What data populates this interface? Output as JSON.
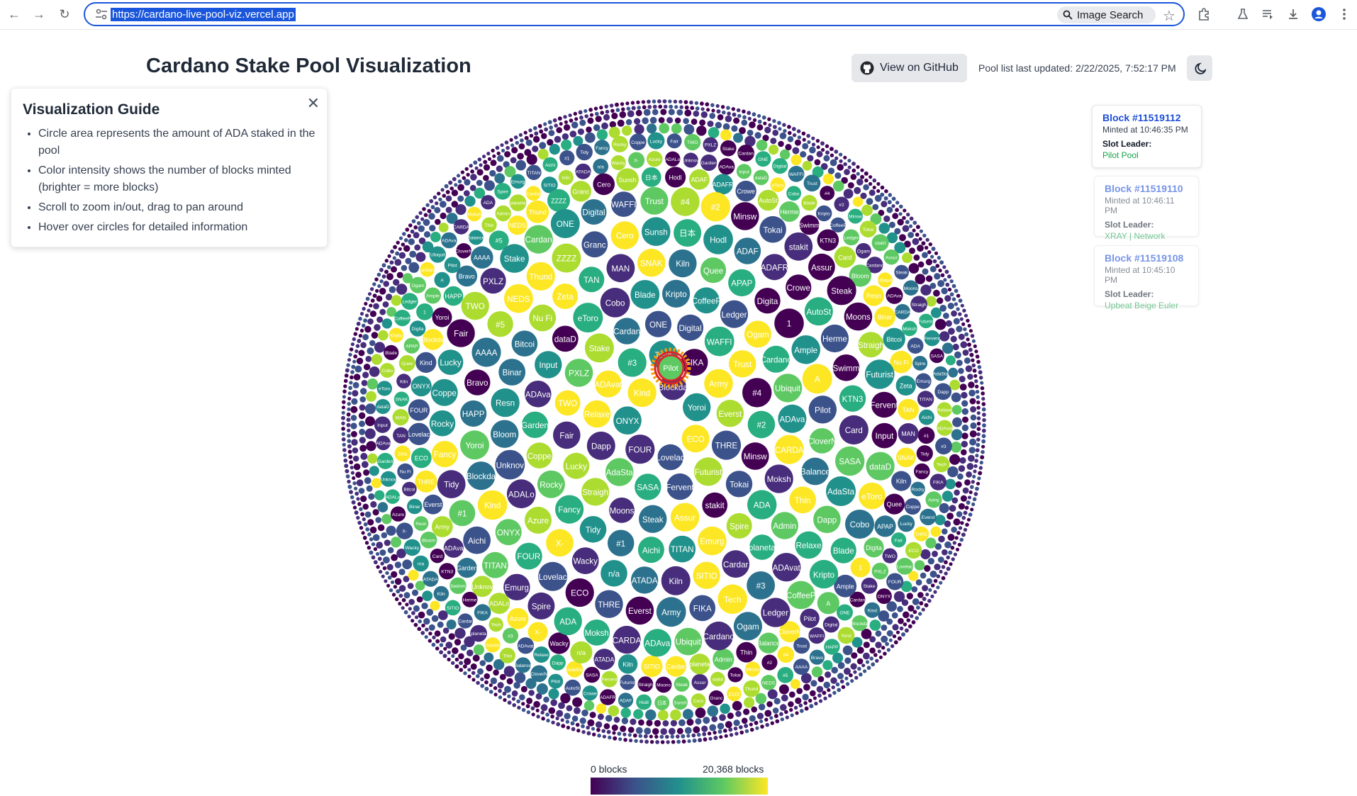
{
  "browser": {
    "url": "https://cardano-live-pool-viz.vercel.app",
    "image_search_label": "Image Search"
  },
  "header": {
    "title": "Cardano Stake Pool Visualization",
    "github_label": "View on GitHub",
    "updated": "Pool list last updated: 2/22/2025, 7:52:17 PM"
  },
  "guide": {
    "title": "Visualization Guide",
    "items": [
      "Circle area represents the amount of ADA staked in the pool",
      "Color intensity shows the number of blocks minted (brighter = more blocks)",
      "Scroll to zoom in/out, drag to pan around",
      "Hover over circles for detailed information"
    ]
  },
  "blocks": [
    {
      "number": "Block #11519112",
      "time": "Minted at 10:46:35 PM",
      "label": "Slot Leader:",
      "leader": "Pilot Pool"
    },
    {
      "number": "Block #11519110",
      "time": "Minted at 10:46:11 PM",
      "label": "Slot Leader:",
      "leader": "XRAY | Network"
    },
    {
      "number": "Block #11519108",
      "time": "Minted at 10:45:10 PM",
      "label": "Slot Leader:",
      "leader": "Upbeat Beige Euler"
    }
  ],
  "legend": {
    "min": "0 blocks",
    "max": "20,368 blocks",
    "colors": [
      "#440154",
      "#3b528b",
      "#21918c",
      "#5ec962",
      "#fde725"
    ]
  },
  "pools": {
    "highlighted": "Pilot",
    "labels": [
      "Pilot",
      "CloverN",
      "Balance",
      "Thin",
      "Admin",
      "planeta",
      "Cardar",
      "SITIO",
      "Kiln",
      "ATADA",
      "n/a",
      "Wacky",
      "X-",
      "Azure",
      "ADALo",
      "Unknov",
      "Garden",
      "ADAva",
      "Input",
      "dataD",
      "eToro",
      "Cobo",
      "Blade",
      "Kripto",
      "CoffeeP",
      "Ledger",
      "Ogam",
      "Cardano",
      "Ubiquit",
      "ADAva",
      "CARDA",
      "Moksh",
      "ADA",
      "Spire",
      "Emurg",
      "TITAN",
      "Aichi",
      "#1",
      "Tidy",
      "Fancy",
      "Rocky",
      "Coppe",
      "Lucky",
      "Fair",
      "TWO",
      "PXLZ",
      "Stake",
      "Cardan",
      "ONE",
      "Digital",
      "WAFFI",
      "Trust",
      "#4",
      "#2",
      "Minsw",
      "Tokai",
      "stakit",
      "Assur",
      "Steak",
      "Moons",
      "Straigh",
      "Futurist",
      "Fervent",
      "SASA",
      "AdaSta",
      "Dapp",
      "Relaxe",
      "ADAvat",
      "#3",
      "Tech",
      "FIKA",
      "Army",
      "Everst",
      "THRE",
      "ECO",
      "Lovelac",
      "FOUR",
      "ONYX",
      "Kind",
      "Blockda",
      "Yoroi",
      "HAPP",
      "Bravo",
      "AAAA",
      "#5",
      "NEDS",
      "Thund",
      "ZZZZ",
      "Granc",
      "Cero",
      "Sunsh",
      "日本",
      "Hodl",
      "ADAF",
      "ADAFR",
      "Crowe",
      "AutoSt",
      "Herme",
      "Swimm",
      "KTN3",
      "Card",
      "Bloom",
      "Resn",
      "Binar",
      "Bitcoi",
      "Nu Fi",
      "Zeta",
      "TAN",
      "MAN",
      "SNAK",
      "Kiln",
      "Quee",
      "APAP",
      "Digita",
      "1",
      "Ample",
      "A"
    ]
  }
}
